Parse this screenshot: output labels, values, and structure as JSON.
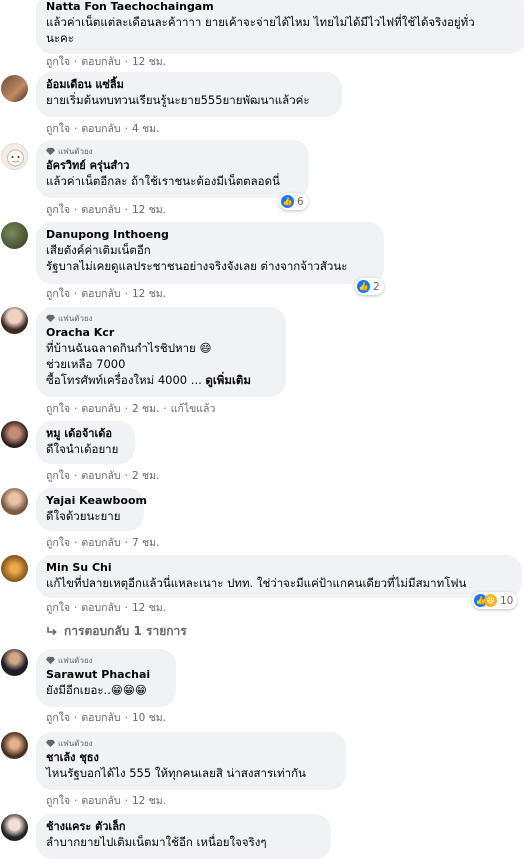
{
  "comments": [
    {
      "name": "Natta Fon Taechochaingam",
      "lines": [
        "แล้วค่าเน็ตแต่ละเดือนละค้าาาา ยายเค้าจะจ่ายได้ไหม ไทยไม่ได้มีไวไฟที่ใช้ได้จริงอยู่ทั่ว",
        "นะคะ"
      ],
      "like": "ถูกใจ",
      "reply": "ตอบกลับ",
      "time": "12 ชม."
    },
    {
      "name": "อ้อมเดือน แซ่ลิ้ม",
      "lines": [
        "ยายเริ่มต้นทบทวนเรียนรู้นะยาย555ยายพัฒนาแล้วค่ะ"
      ],
      "like": "ถูกใจ",
      "reply": "ตอบกลับ",
      "time": "4 ชม."
    },
    {
      "badge": "แฟนตัวยง",
      "name": "อัครวิทย์ ครุ่นสำว",
      "lines": [
        "แล้วค่าเน็ตอีกละ ถ้าใช้เราชนะต้องมีเน็ตตลอดนี่"
      ],
      "like": "ถูกใจ",
      "reply": "ตอบกลับ",
      "time": "12 ชม.",
      "reaction_count": "6"
    },
    {
      "name": "Danupong Inthoeng",
      "lines": [
        "เสียตังค์ค่าเติมเน็ตอีก",
        "รัฐบาลไม่เคยดูแลประชาชนอย่างจริงจังเลย ต่างจากจ้าวสัวนะ"
      ],
      "like": "ถูกใจ",
      "reply": "ตอบกลับ",
      "time": "12 ชม.",
      "reaction_count": "2"
    },
    {
      "badge": "แฟนตัวยง",
      "name": "Oracha Kcr",
      "lines": [
        "ที่บ้านฉันฉลาดกินกำไรชิปหาย 😄",
        "ช่วยเหลือ 7000",
        "ซื้อโทรศัพท์เครื่องใหม่ 4000 ..."
      ],
      "see_more": "ดูเพิ่มเติม",
      "like": "ถูกใจ",
      "reply": "ตอบกลับ",
      "time": "2 ชม.",
      "edited": "แก้ไขแล้ว"
    },
    {
      "name": "หมู เด้อจ้าเด้อ",
      "lines": [
        "ดีใจนำเด้อยาย"
      ],
      "like": "ถูกใจ",
      "reply": "ตอบกลับ",
      "time": "2 ชม."
    },
    {
      "name": "Yajai Keawboom",
      "lines": [
        "ดีใจด้วยนะยาย"
      ],
      "like": "ถูกใจ",
      "reply": "ตอบกลับ",
      "time": "7 ชม."
    },
    {
      "name": "Min Su Chi",
      "lines": [
        "แก้ไขที่ปลายเหตุอีกแล้วนี่แหละเนาะ ปทท. ใช่ว่าจะมีแค่ป้าแกคนเดียวที่ไม่มีสมาทโฟน"
      ],
      "like": "ถูกใจ",
      "reply": "ตอบกลับ",
      "time": "12 ชม.",
      "reaction_count": "10"
    },
    {
      "badge": "แฟนตัวยง",
      "name": "Sarawut Phachai",
      "lines": [
        "ยังมีอีกเยอะ..😁😁😁"
      ],
      "like": "ถูกใจ",
      "reply": "ตอบกลับ",
      "time": "10 ชม."
    },
    {
      "badge": "แฟนตัวยง",
      "name": "ชาเล้ง ชุธง",
      "lines": [
        "ไหนรัฐบอกได้ไง 555 ให้ทุกคนเลยสิ น่าสงสารเท่ากัน"
      ],
      "like": "ถูกใจ",
      "reply": "ตอบกลับ",
      "time": "12 ชม."
    },
    {
      "name": "ช้างแคระ ตัวเล็ก",
      "lines": [
        "ลำบากยายไปเติมเน็ตมาใช้อีก เหนื่อยใจจริงๆ"
      ]
    }
  ],
  "replies_link": "การตอบกลับ 1 รายการ",
  "colors": {
    "bubble": "#f0f2f5",
    "meta": "#65676b",
    "like_blue": "#1877f2"
  }
}
